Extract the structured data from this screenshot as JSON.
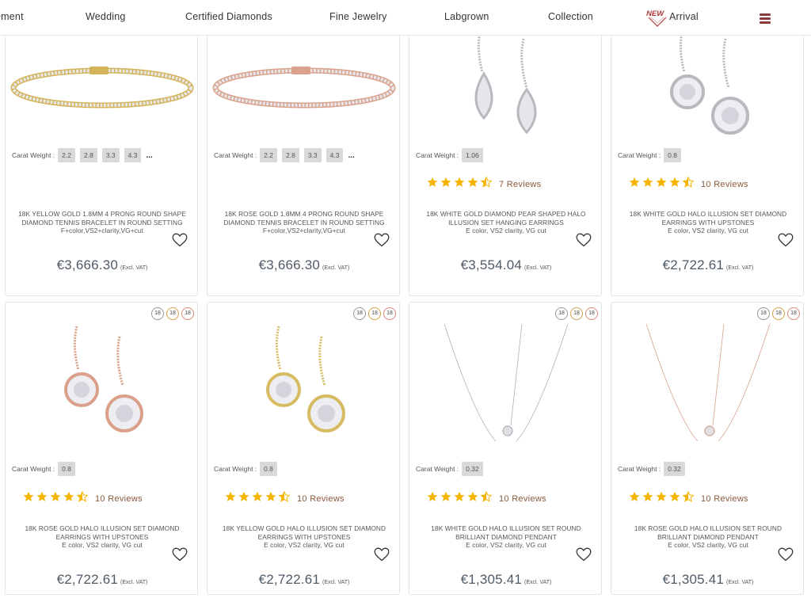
{
  "nav": {
    "items": [
      "ement",
      "Wedding",
      "Certified Diamonds",
      "Fine Jewelry",
      "Labgrown",
      "Collection",
      "Arrival"
    ],
    "new_badge": "NEW"
  },
  "colors": {
    "price": "#4f5b66",
    "star": "#f5b400",
    "reviews": "#8a5a3c",
    "chip": "#d9d9d9",
    "accent": "#b23a3a"
  },
  "carat_label": "Carat Weight :",
  "vat_label": "(Excl. VAT)",
  "products": [
    {
      "image": "yellow-gold-tennis-bracelet",
      "carats": [
        "2.2",
        "2.8",
        "3.3",
        "4.3"
      ],
      "more": "...",
      "rating": null,
      "reviews": "",
      "title": "18K YELLOW GOLD 1.8MM 4 PRONG ROUND SHAPE DIAMOND TENNIS BRACELET IN ROUND SETTING",
      "spec": "F+color,VS2+clarity,VG+cut",
      "price": "€3,666.30"
    },
    {
      "image": "rose-gold-tennis-bracelet",
      "carats": [
        "2.2",
        "2.8",
        "3.3",
        "4.3"
      ],
      "more": "...",
      "rating": null,
      "reviews": "",
      "title": "18K ROSE GOLD 1.8MM 4 PRONG ROUND SHAPE DIAMOND TENNIS BRACELET IN ROUND SETTING",
      "spec": "F+color,VS2+clarity,VG+cut",
      "price": "€3,666.30"
    },
    {
      "image": "white-gold-pear-earrings",
      "carats": [
        "1.06"
      ],
      "more": "",
      "rating": 4.5,
      "reviews": "7 Reviews",
      "title": "18K WHITE GOLD DIAMOND PEAR SHAPED HALO ILLUSION SET HANGING EARRINGS",
      "spec": "E color, VS2 clarity, VG cut",
      "price": "€3,554.04"
    },
    {
      "image": "white-gold-halo-earrings",
      "carats": [
        "0.8"
      ],
      "more": "",
      "rating": 4.5,
      "reviews": "10 Reviews",
      "title": "18K WHITE GOLD HALO ILLUSION SET DIAMOND EARRINGS WITH UPSTONES",
      "spec": "E color, VS2 clarity, VG cut",
      "price": "€2,722.61"
    },
    {
      "image": "rose-gold-halo-earrings",
      "metals": [
        "18",
        "18",
        "18"
      ],
      "carats": [
        "0.8"
      ],
      "more": "",
      "rating": 4.5,
      "reviews": "10 Reviews",
      "title": "18K ROSE GOLD HALO ILLUSION SET DIAMOND EARRINGS WITH UPSTONES",
      "spec": "E color, VS2 clarity, VG cut",
      "price": "€2,722.61"
    },
    {
      "image": "yellow-gold-halo-earrings",
      "metals": [
        "18",
        "18",
        "18"
      ],
      "carats": [
        "0.8"
      ],
      "more": "",
      "rating": 4.5,
      "reviews": "10 Reviews",
      "title": "18K YELLOW GOLD HALO ILLUSION SET DIAMOND EARRINGS WITH UPSTONES",
      "spec": "E color, VS2 clarity, VG cut",
      "price": "€2,722.61"
    },
    {
      "image": "white-gold-pendant",
      "metals": [
        "18",
        "18",
        "18"
      ],
      "carats": [
        "0.32"
      ],
      "more": "",
      "rating": 4.5,
      "reviews": "10 Reviews",
      "title": "18K WHITE GOLD HALO ILLUSION SET ROUND BRILLIANT DIAMOND PENDANT",
      "spec": "E color, VS2 clarity, VG cut",
      "price": "€1,305.41"
    },
    {
      "image": "rose-gold-pendant",
      "metals": [
        "18",
        "18",
        "18"
      ],
      "carats": [
        "0.32"
      ],
      "more": "",
      "rating": 4.5,
      "reviews": "10 Reviews",
      "title": "18K ROSE GOLD HALO ILLUSION SET ROUND BRILLIANT DIAMOND PENDANT",
      "spec": "E color, VS2 clarity, VG cut",
      "price": "€1,305.41"
    }
  ]
}
